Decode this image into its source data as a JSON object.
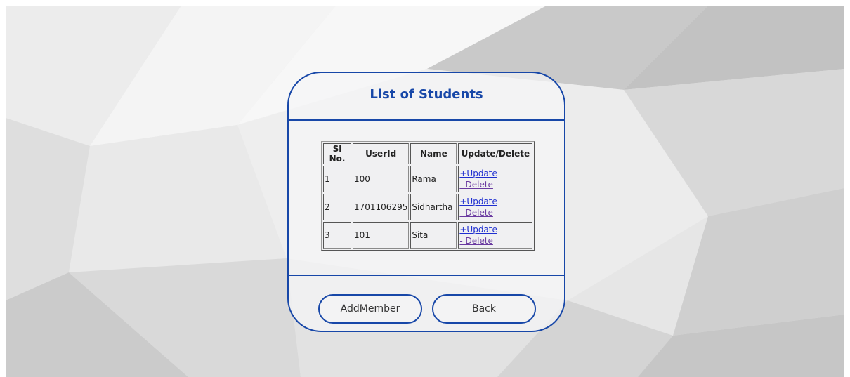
{
  "page": {
    "title": "List of Students"
  },
  "table": {
    "headers": [
      "Sl No.",
      "UserId",
      "Name",
      "Update/Delete"
    ],
    "rows": [
      {
        "sl": "1",
        "userid": "100",
        "name": "Rama",
        "update": "+Update",
        "delete": "- Delete"
      },
      {
        "sl": "2",
        "userid": "1701106295",
        "name": "Sidhartha",
        "update": "+Update",
        "delete": "- Delete"
      },
      {
        "sl": "3",
        "userid": "101",
        "name": "Sita",
        "update": "+Update",
        "delete": "- Delete"
      }
    ]
  },
  "buttons": {
    "add_member": "AddMember",
    "back": "Back"
  },
  "colors": {
    "accent": "#1747a8",
    "link": "#1f2fd0",
    "visited_link": "#6a3aa0"
  }
}
